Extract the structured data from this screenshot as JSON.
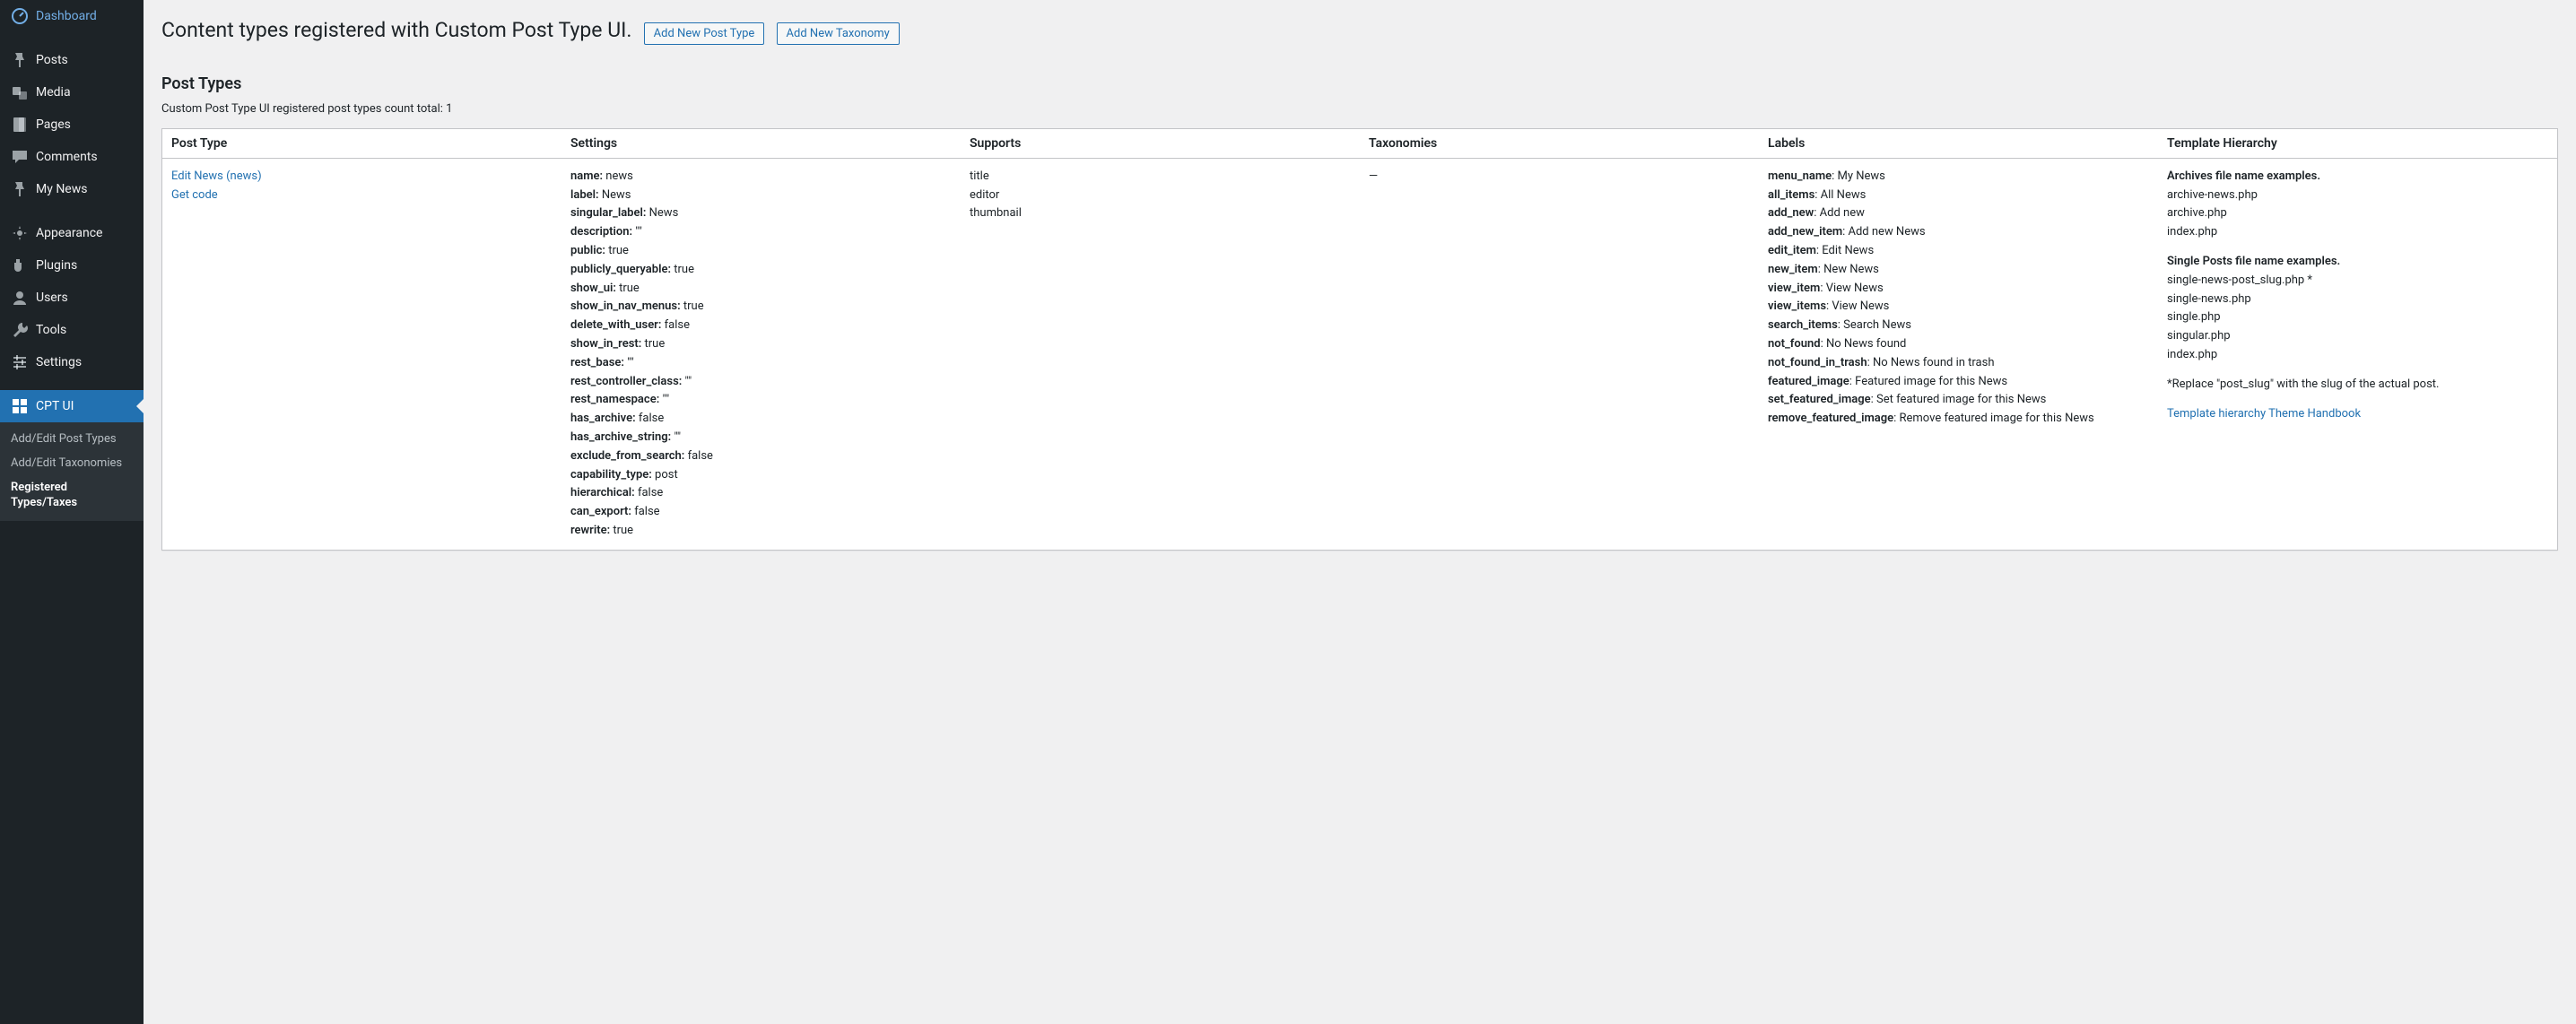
{
  "sidebar": {
    "items": [
      {
        "label": "Dashboard",
        "icon": "dashboard"
      },
      {
        "label": "Posts",
        "icon": "pin"
      },
      {
        "label": "Media",
        "icon": "media"
      },
      {
        "label": "Pages",
        "icon": "page"
      },
      {
        "label": "Comments",
        "icon": "comment"
      },
      {
        "label": "My News",
        "icon": "pin"
      },
      {
        "label": "Appearance",
        "icon": "appearance"
      },
      {
        "label": "Plugins",
        "icon": "plugin"
      },
      {
        "label": "Users",
        "icon": "user"
      },
      {
        "label": "Tools",
        "icon": "tool"
      },
      {
        "label": "Settings",
        "icon": "settings"
      },
      {
        "label": "CPT UI",
        "icon": "cptui"
      }
    ],
    "separators_after": [
      0,
      5,
      10
    ],
    "current_index": 11,
    "submenu": {
      "items": [
        {
          "label": "Add/Edit Post Types"
        },
        {
          "label": "Add/Edit Taxonomies"
        },
        {
          "label": "Registered Types/Taxes"
        }
      ],
      "current_index": 2
    }
  },
  "header": {
    "title": "Content types registered with Custom Post Type UI.",
    "add_post_type_label": "Add New Post Type",
    "add_taxonomy_label": "Add New Taxonomy"
  },
  "section": {
    "heading": "Post Types",
    "count_text": "Custom Post Type UI registered post types count total: 1"
  },
  "table": {
    "columns": {
      "post_type": "Post Type",
      "settings": "Settings",
      "supports": "Supports",
      "taxonomies": "Taxonomies",
      "labels": "Labels",
      "template": "Template Hierarchy"
    },
    "row": {
      "post_type_links": {
        "edit": "Edit News (news)",
        "get_code": "Get code"
      },
      "settings": [
        {
          "k": "name:",
          "v": " news"
        },
        {
          "k": "label:",
          "v": " News"
        },
        {
          "k": "singular_label:",
          "v": " News"
        },
        {
          "k": "description:",
          "v": " \"\""
        },
        {
          "k": "public:",
          "v": " true"
        },
        {
          "k": "publicly_queryable:",
          "v": " true"
        },
        {
          "k": "show_ui:",
          "v": " true"
        },
        {
          "k": "show_in_nav_menus:",
          "v": " true"
        },
        {
          "k": "delete_with_user:",
          "v": " false"
        },
        {
          "k": "show_in_rest:",
          "v": " true"
        },
        {
          "k": "rest_base:",
          "v": " \"\""
        },
        {
          "k": "rest_controller_class:",
          "v": " \"\""
        },
        {
          "k": "rest_namespace:",
          "v": " \"\""
        },
        {
          "k": "has_archive:",
          "v": " false"
        },
        {
          "k": "has_archive_string:",
          "v": " \"\""
        },
        {
          "k": "exclude_from_search:",
          "v": " false"
        },
        {
          "k": "capability_type:",
          "v": " post"
        },
        {
          "k": "hierarchical:",
          "v": " false"
        },
        {
          "k": "can_export:",
          "v": " false"
        },
        {
          "k": "rewrite:",
          "v": " true"
        }
      ],
      "supports": [
        "title",
        "editor",
        "thumbnail"
      ],
      "taxonomies": "—",
      "labels": [
        {
          "k": "menu_name",
          "v": ": My News"
        },
        {
          "k": "all_items",
          "v": ": All News"
        },
        {
          "k": "add_new",
          "v": ": Add new"
        },
        {
          "k": "add_new_item",
          "v": ": Add new News"
        },
        {
          "k": "edit_item",
          "v": ": Edit News"
        },
        {
          "k": "new_item",
          "v": ": New News"
        },
        {
          "k": "view_item",
          "v": ": View News"
        },
        {
          "k": "view_items",
          "v": ": View News"
        },
        {
          "k": "search_items",
          "v": ": Search News"
        },
        {
          "k": "not_found",
          "v": ": No News found"
        },
        {
          "k": "not_found_in_trash",
          "v": ": No News found in trash"
        },
        {
          "k": "featured_image",
          "v": ": Featured image for this News"
        },
        {
          "k": "set_featured_image",
          "v": ": Set featured image for this News"
        },
        {
          "k": "remove_featured_image",
          "v": ": Remove featured image for this News"
        }
      ],
      "template": {
        "archives_title": "Archives file name examples.",
        "archives": [
          "archive-news.php",
          "archive.php",
          "index.php"
        ],
        "single_title": "Single Posts file name examples.",
        "singles": [
          "single-news-post_slug.php *",
          "single-news.php",
          "single.php",
          "singular.php",
          "index.php"
        ],
        "note": "*Replace \"post_slug\" with the slug of the actual post.",
        "handbook_link": "Template hierarchy Theme Handbook"
      }
    }
  }
}
